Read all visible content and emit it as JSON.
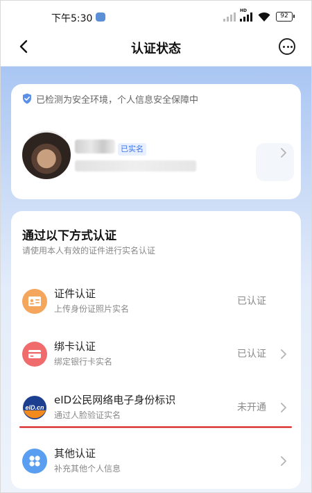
{
  "status_bar": {
    "time": "下午5:30",
    "battery": "92",
    "network_label": "HD"
  },
  "nav": {
    "title": "认证状态"
  },
  "user_card": {
    "secure_notice": "已检测为安全环境，个人信息安全保障中",
    "verified_badge": "已实名"
  },
  "methods": {
    "title": "通过以下方式认证",
    "subtitle": "请使用本人有效的证件进行实名认证",
    "items": [
      {
        "title": "证件认证",
        "desc": "上传身份证照片实名",
        "status": "已认证",
        "icon": "id-card-icon"
      },
      {
        "title": "绑卡认证",
        "desc": "绑定银行卡实名",
        "status": "已认证",
        "icon": "bank-card-icon"
      },
      {
        "title": "eID公民网络电子身份标识",
        "desc": "通过人脸验证实名",
        "status": "未开通",
        "icon": "eid-logo-icon",
        "icon_text": "eID.cn"
      },
      {
        "title": "其他认证",
        "desc": "补充其他个人信息",
        "status": "",
        "icon": "grid-icon"
      }
    ]
  },
  "colors": {
    "accent_blue": "#3d73e6",
    "annotation_red": "#d92323",
    "gradient_top": "#a9c6f3"
  }
}
